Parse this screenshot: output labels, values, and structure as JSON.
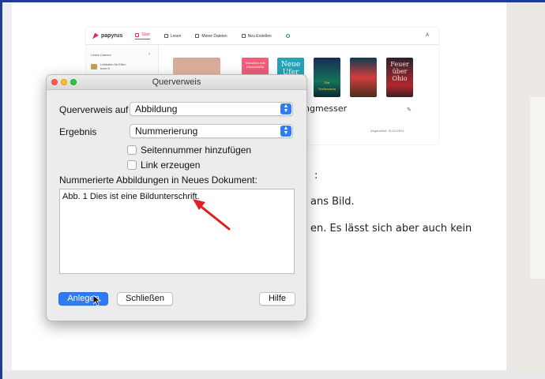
{
  "background_app": {
    "logo": "papyrus",
    "nav": [
      {
        "label": "Start",
        "active": true
      },
      {
        "label": "Lesen",
        "active": false
      },
      {
        "label": "Meine Dateien",
        "active": false
      },
      {
        "label": "Neu Erstellen",
        "active": false
      }
    ],
    "avatar": "A",
    "sidebar": {
      "heading": "Letzte Dateien",
      "file_title": "Leitfaden für Elfen",
      "file_sub": "buch h"
    },
    "covers": [
      {
        "title": ""
      },
      {
        "title": "Tomaten mit Mozzarella"
      },
      {
        "title": "Neue Ufer"
      },
      {
        "title": "Die Verlorenen"
      },
      {
        "title": ""
      },
      {
        "title": "Feuer über Ohio"
      }
    ],
    "book_title_fragment": "ngmesser",
    "meta": "Abgabefrist: 31/12/2024"
  },
  "document": {
    "line1": ":",
    "line2": "ans Bild.",
    "line3": "en. Es lässt sich aber auch kein"
  },
  "dialog": {
    "title": "Querverweis",
    "ref_label": "Querverweis auf",
    "ref_value": "Abbildung",
    "result_label": "Ergebnis",
    "result_value": "Nummerierung",
    "checkbox_page": "Seitennummer hinzufügen",
    "checkbox_link": "Link erzeugen",
    "list_label": "Nummerierte Abbildungen in Neues Dokument:",
    "list_items": [
      "Abb. 1 Dies ist eine Bildunterschrift."
    ],
    "btn_create": "Anlegen",
    "btn_close": "Schließen",
    "btn_help": "Hilfe"
  },
  "colors": {
    "accent": "#2f7bf6",
    "annotation_arrow": "#e02020",
    "frame": "#1c3f8f"
  }
}
